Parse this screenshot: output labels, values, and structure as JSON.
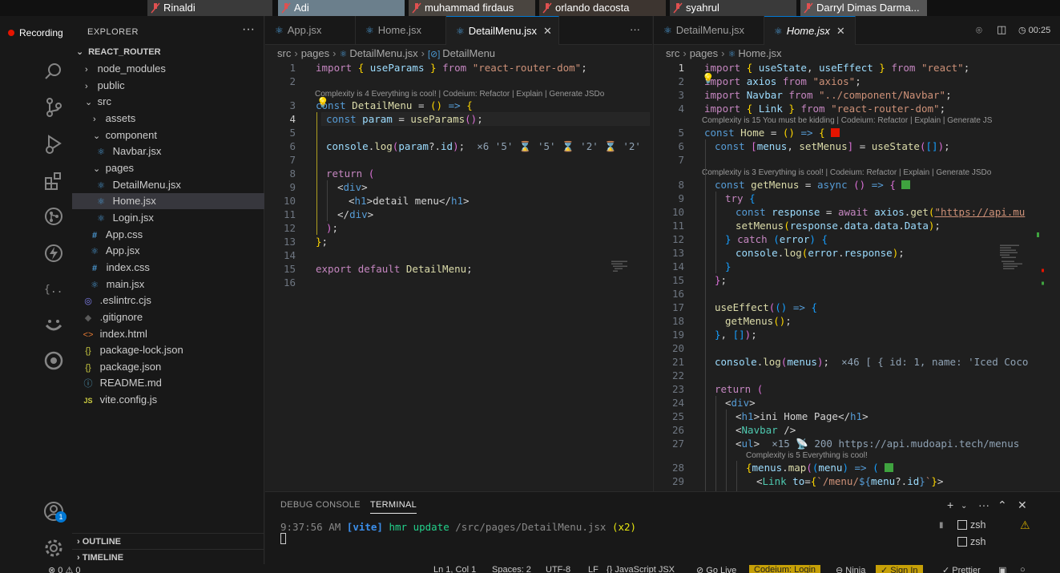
{
  "meeting": {
    "participants": [
      {
        "name": "Rinaldi"
      },
      {
        "name": "Adi"
      },
      {
        "name": "muhammad firdaus"
      },
      {
        "name": "orlando dacosta"
      },
      {
        "name": "syahrul"
      },
      {
        "name": "Darryl Dimas Darma..."
      }
    ],
    "recording_label": "Recording",
    "timer": "00:25"
  },
  "explorer": {
    "title": "EXPLORER",
    "root": "REACT_ROUTER",
    "items": [
      {
        "label": "node_modules",
        "type": "folder",
        "open": false
      },
      {
        "label": "public",
        "type": "folder",
        "open": false
      },
      {
        "label": "src",
        "type": "folder",
        "open": true
      },
      {
        "label": "assets",
        "type": "folder",
        "open": false
      },
      {
        "label": "component",
        "type": "folder",
        "open": true
      },
      {
        "label": "Navbar.jsx",
        "type": "jsx"
      },
      {
        "label": "pages",
        "type": "folder",
        "open": true
      },
      {
        "label": "DetailMenu.jsx",
        "type": "jsx"
      },
      {
        "label": "Home.jsx",
        "type": "jsx"
      },
      {
        "label": "Login.jsx",
        "type": "jsx"
      },
      {
        "label": "App.css",
        "type": "css"
      },
      {
        "label": "App.jsx",
        "type": "jsx"
      },
      {
        "label": "index.css",
        "type": "css"
      },
      {
        "label": "main.jsx",
        "type": "jsx"
      },
      {
        "label": ".eslintrc.cjs",
        "type": "eslint"
      },
      {
        "label": ".gitignore",
        "type": "git"
      },
      {
        "label": "index.html",
        "type": "html"
      },
      {
        "label": "package-lock.json",
        "type": "json"
      },
      {
        "label": "package.json",
        "type": "json"
      },
      {
        "label": "README.md",
        "type": "info"
      },
      {
        "label": "vite.config.js",
        "type": "js"
      }
    ],
    "outline": "OUTLINE",
    "timeline": "TIMELINE",
    "accounts_badge": "1"
  },
  "editor_left": {
    "tabs": [
      {
        "label": "App.jsx",
        "active": false
      },
      {
        "label": "Home.jsx",
        "active": false
      },
      {
        "label": "DetailMenu.jsx",
        "active": true
      }
    ],
    "more": "···",
    "breadcrumb": [
      "src",
      "pages",
      "DetailMenu.jsx",
      "DetailMenu"
    ],
    "lens_1": "Complexity is 4 Everything is cool! | Codeium: Refactor | Explain | Generate JSDo",
    "inline_hint": "×6 '5' ⌛ '5' ⌛ '2' ⌛ '2'"
  },
  "editor_right": {
    "tabs": [
      {
        "label": "DetailMenu.jsx",
        "active": false
      },
      {
        "label": "Home.jsx",
        "active": true
      }
    ],
    "breadcrumb": [
      "src",
      "pages",
      "Home.jsx"
    ],
    "lens_1": "Complexity is 15 You must be kidding | Codeium: Refactor | Explain | Generate JS",
    "lens_2": "Complexity is 3 Everything is cool! | Codeium: Refactor | Explain | Generate JSDo",
    "lens_3": "Complexity is 5 Everything is cool!",
    "hint_menus": "×46 [ { id: 1, name: 'Iced Coco",
    "hint_ul": "×15 📡 200 https://api.mudoapi.tech/menus",
    "url": "\"https://api.mu"
  },
  "panel": {
    "tabs": [
      "DEBUG CONSOLE",
      "TERMINAL"
    ],
    "active_tab": "TERMINAL",
    "terminal": {
      "time": "9:37:56 AM",
      "tag": "[vite]",
      "msg": "hmr update",
      "path": "/src/pages/DetailMenu.jsx",
      "count": "(x2)"
    },
    "shells": [
      "zsh",
      "zsh"
    ]
  },
  "statusbar": {
    "errors": "⊗ 0 ⚠ 0",
    "position": "Ln 1, Col 1",
    "spaces": "Spaces: 2",
    "encoding": "UTF-8",
    "eol": "LF",
    "language": "{} JavaScript JSX",
    "golive": "⊘ Go Live",
    "codeium": "Codeium: Login",
    "ninja": "⊖ Ninja",
    "signin": "✓ Sign In",
    "prettier": "✓ Prettier"
  },
  "colors": {
    "accent": "#0078d4",
    "recording": "#e51400",
    "warning_badge": "#c6a007"
  }
}
